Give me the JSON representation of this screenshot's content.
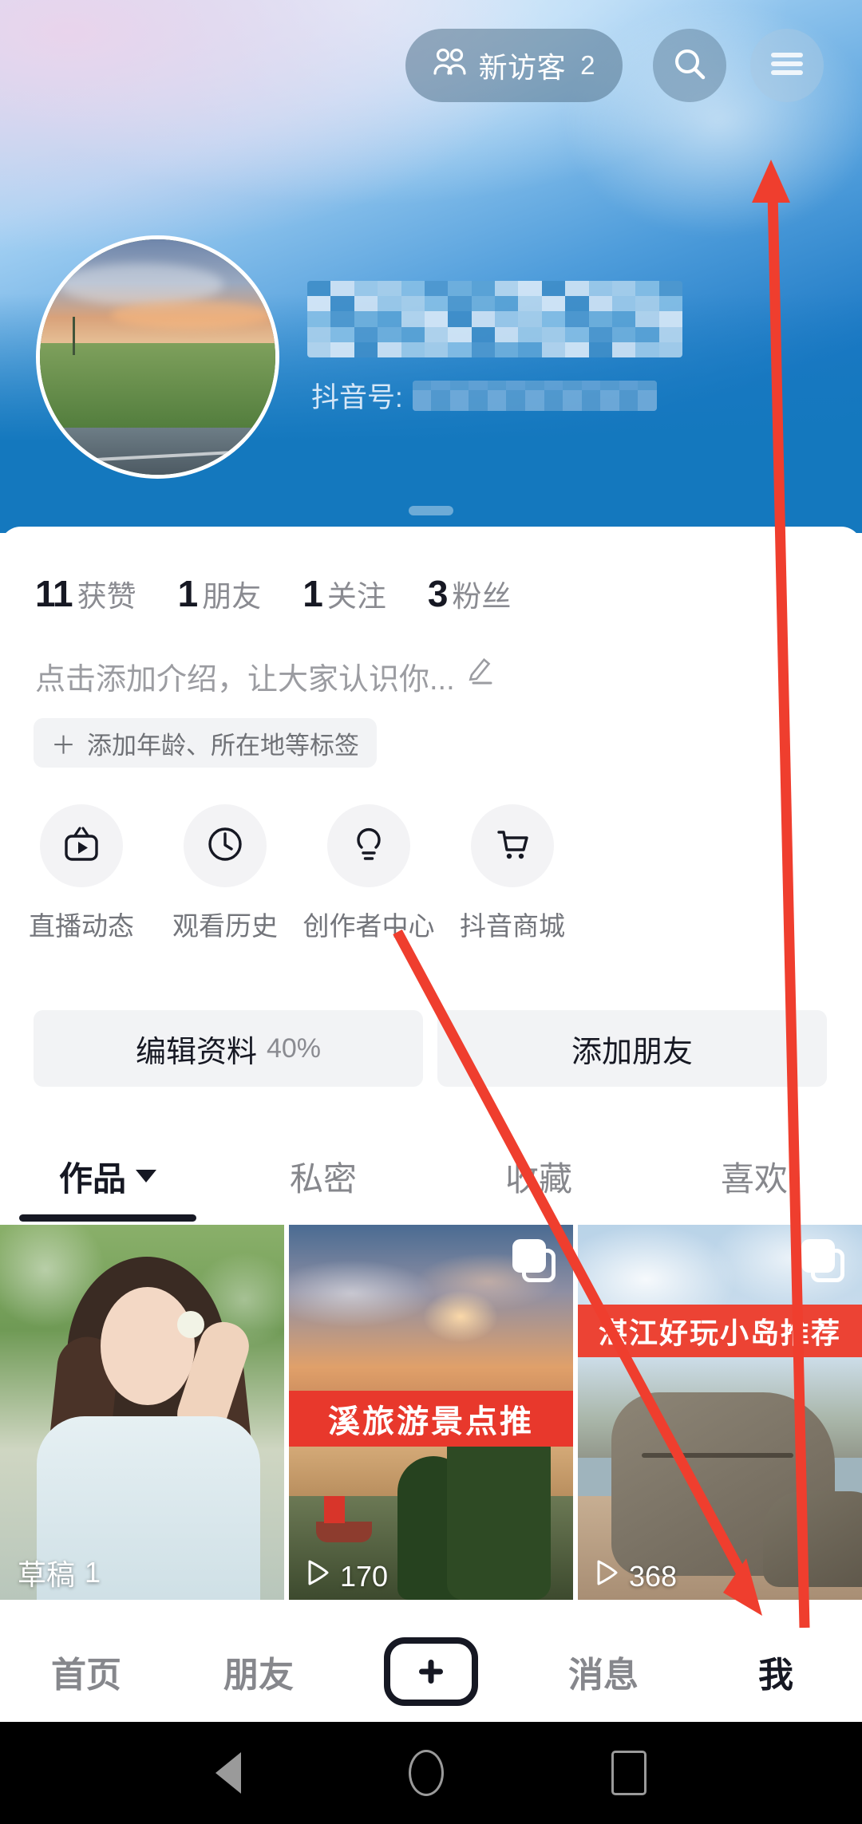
{
  "app": {
    "name": "douyin-profile"
  },
  "header": {
    "visitors_icon": "people-icon",
    "visitors_label": "新访客",
    "visitors_count": "2",
    "search_icon": "search-icon",
    "menu_icon": "hamburger-menu-icon",
    "display_name": "",
    "id_label": "抖音号:",
    "id_value": ""
  },
  "stats": [
    {
      "num": "11",
      "label": "获赞"
    },
    {
      "num": "1",
      "label": "朋友"
    },
    {
      "num": "1",
      "label": "关注"
    },
    {
      "num": "3",
      "label": "粉丝"
    }
  ],
  "bio": {
    "placeholder": "点击添加介绍，让大家认识你...",
    "edit_icon": "pencil-icon",
    "tag_plus": "＋",
    "tag_label": "添加年龄、所在地等标签"
  },
  "quick_actions": [
    {
      "icon": "tv-live-icon",
      "label": "直播动态"
    },
    {
      "icon": "clock-history-icon",
      "label": "观看历史"
    },
    {
      "icon": "lightbulb-icon",
      "label": "创作者中心"
    },
    {
      "icon": "shopping-cart-icon",
      "label": "抖音商城"
    }
  ],
  "action_buttons": {
    "edit_label": "编辑资料",
    "edit_percent": "40%",
    "add_friend_label": "添加朋友"
  },
  "tabs": [
    {
      "label": "作品",
      "active": true,
      "caret": "chevron-down-icon"
    },
    {
      "label": "私密",
      "active": false
    },
    {
      "label": "收藏",
      "active": false
    },
    {
      "label": "喜欢",
      "active": false
    }
  ],
  "grid": [
    {
      "badge_label": "草稿",
      "badge_count": "1",
      "overlay_text": "",
      "multi": false
    },
    {
      "play_icon": "play-icon",
      "plays": "170",
      "overlay_text": "溪旅游景点推",
      "multi": true
    },
    {
      "play_icon": "play-icon",
      "plays": "368",
      "overlay_text": "湛江好玩小岛推荐",
      "multi": true
    }
  ],
  "bottom_nav": [
    {
      "label": "首页",
      "active": false
    },
    {
      "label": "朋友",
      "active": false
    },
    {
      "label": "",
      "icon": "plus-create-icon",
      "active": false
    },
    {
      "label": "消息",
      "active": false
    },
    {
      "label": "我",
      "active": true
    }
  ],
  "android_nav": {
    "back_icon": "triangle-back-icon",
    "home_icon": "circle-home-icon",
    "recents_icon": "square-recents-icon"
  },
  "annotations": {
    "color": "#ef3e2e",
    "arrow_up_name": "arrow-to-menu-button",
    "arrow_down_name": "arrow-to-me-tab"
  }
}
